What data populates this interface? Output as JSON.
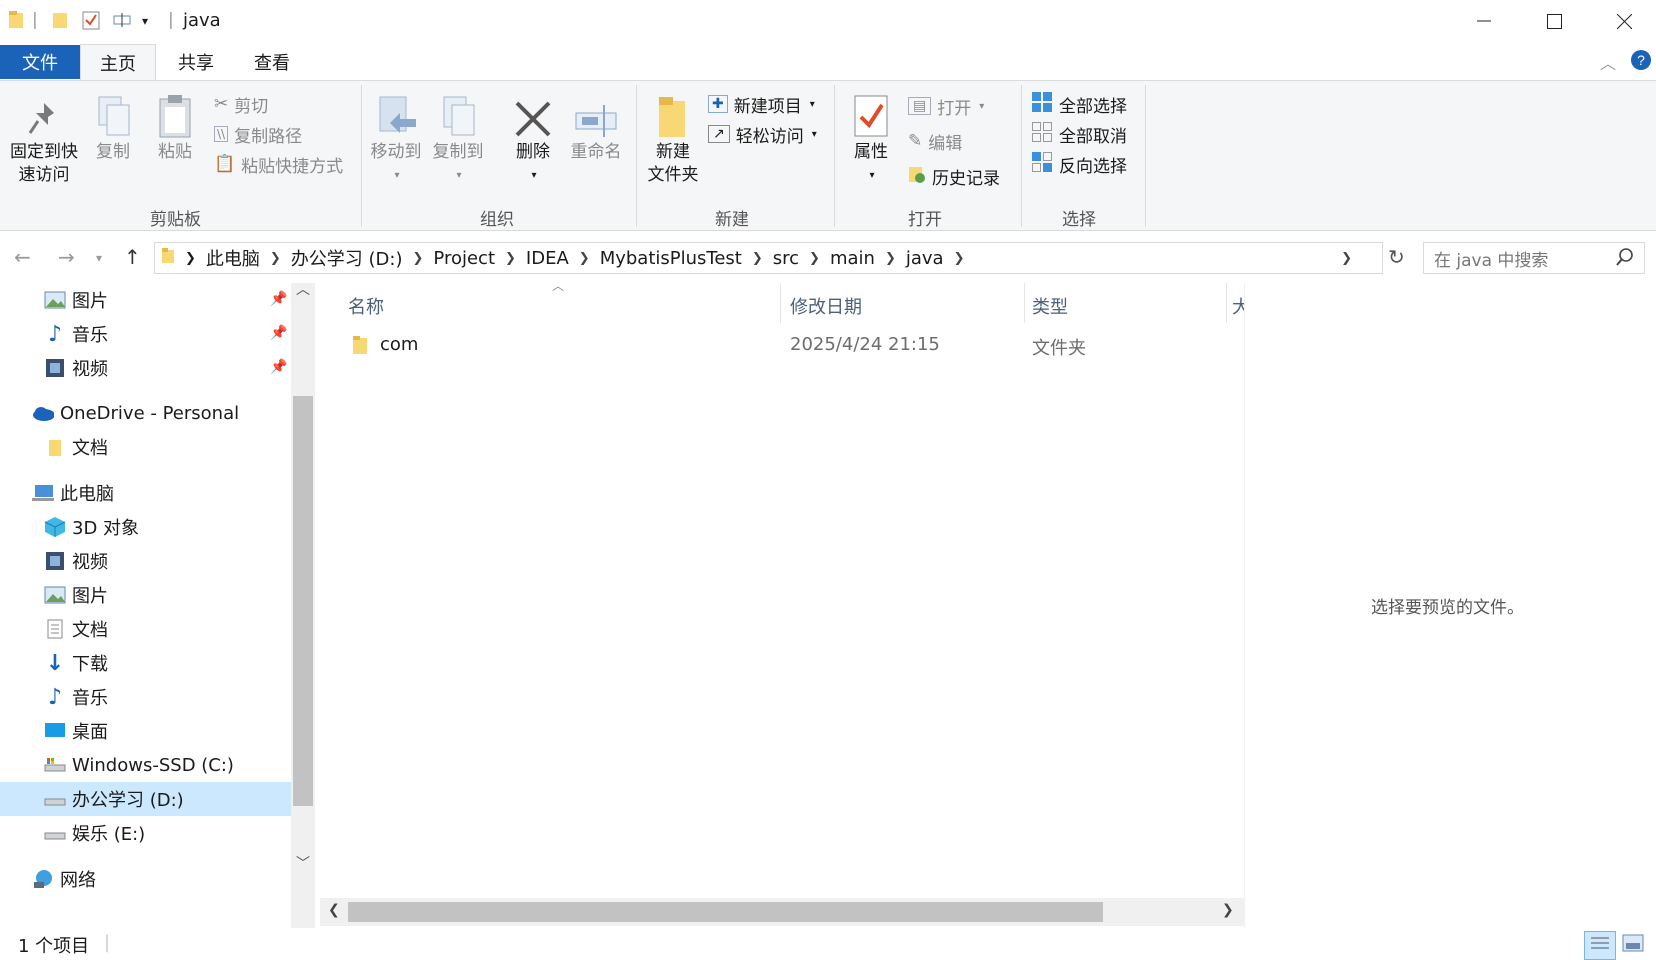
{
  "window": {
    "title": "java",
    "minimize": "—",
    "maximize": "☐",
    "close": "✕"
  },
  "tabs": {
    "file": "文件",
    "home": "主页",
    "share": "共享",
    "view": "查看"
  },
  "ribbon": {
    "clipboard": {
      "label": "剪贴板",
      "pin_line1": "固定到快",
      "pin_line2": "速访问",
      "copy": "复制",
      "paste": "粘贴",
      "cut": "剪切",
      "copy_path": "复制路径",
      "paste_shortcut": "粘贴快捷方式"
    },
    "organize": {
      "label": "组织",
      "move_to": "移动到",
      "copy_to": "复制到",
      "delete": "删除",
      "rename": "重命名"
    },
    "new": {
      "label": "新建",
      "new_folder_line1": "新建",
      "new_folder_line2": "文件夹",
      "new_item": "新建项目",
      "easy_access": "轻松访问"
    },
    "open": {
      "label": "打开",
      "properties": "属性",
      "open": "打开",
      "edit": "编辑",
      "history": "历史记录"
    },
    "select": {
      "label": "选择",
      "select_all": "全部选择",
      "select_none": "全部取消",
      "invert": "反向选择"
    }
  },
  "address": {
    "crumbs": [
      "此电脑",
      "办公学习 (D:)",
      "Project",
      "IDEA",
      "MybatisPlusTest",
      "src",
      "main",
      "java"
    ],
    "search_placeholder": "在 java 中搜索"
  },
  "nav": {
    "quick": [
      {
        "label": "图片",
        "icon": "pictures-icon"
      },
      {
        "label": "音乐",
        "icon": "music-icon"
      },
      {
        "label": "视频",
        "icon": "video-icon"
      }
    ],
    "onedrive": "OneDrive - Personal",
    "onedrive_docs": "文档",
    "this_pc": "此电脑",
    "pc_items": [
      {
        "label": "3D 对象",
        "icon": "3d-objects-icon"
      },
      {
        "label": "视频",
        "icon": "video-icon"
      },
      {
        "label": "图片",
        "icon": "pictures-icon"
      },
      {
        "label": "文档",
        "icon": "documents-icon"
      },
      {
        "label": "下载",
        "icon": "download-icon"
      },
      {
        "label": "音乐",
        "icon": "music-icon"
      },
      {
        "label": "桌面",
        "icon": "desktop-icon"
      },
      {
        "label": "Windows-SSD (C:)",
        "icon": "drive-icon"
      },
      {
        "label": "办公学习 (D:)",
        "icon": "drive-icon"
      },
      {
        "label": "娱乐 (E:)",
        "icon": "drive-icon"
      }
    ],
    "network": "网络"
  },
  "filelist": {
    "columns": {
      "name": "名称",
      "modified": "修改日期",
      "type": "类型",
      "size": "大"
    },
    "rows": [
      {
        "name": "com",
        "modified": "2025/4/24 21:15",
        "type": "文件夹"
      }
    ]
  },
  "preview": {
    "message": "选择要预览的文件。"
  },
  "status": {
    "count": "1 个项目"
  },
  "colors": {
    "accent": "#1a63b8",
    "selected": "#cce8ff",
    "folder": "#f8d775"
  }
}
